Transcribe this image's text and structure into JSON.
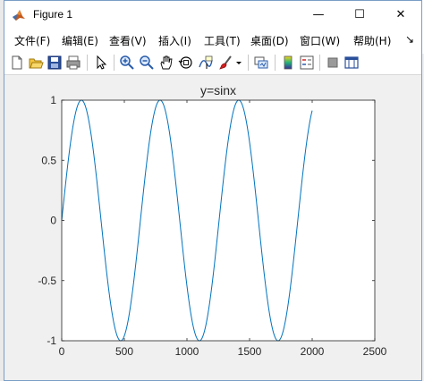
{
  "window": {
    "title": "Figure 1",
    "minimize_glyph": "—",
    "maximize_glyph": "☐",
    "close_glyph": "✕"
  },
  "menu": [
    {
      "label": "文件(F)"
    },
    {
      "label": "编辑(E)"
    },
    {
      "label": "查看(V)"
    },
    {
      "label": "插入(I)"
    },
    {
      "label": "工具(T)"
    },
    {
      "label": "桌面(D)"
    },
    {
      "label": "窗口(W)"
    },
    {
      "label": "帮助(H)"
    },
    {
      "label": "↘"
    }
  ],
  "toolbar": {
    "icons": [
      "new-figure-icon",
      "open-file-icon",
      "save-icon",
      "print-icon",
      "pointer-icon",
      "zoom-in-icon",
      "zoom-out-icon",
      "pan-icon",
      "rotate-3d-icon",
      "data-cursor-icon",
      "brush-icon",
      "brush-dropdown-icon",
      "link-plot-icon",
      "colorbar-icon",
      "legend-icon",
      "hide-plot-tools-icon",
      "show-plot-tools-icon"
    ]
  },
  "colors": {
    "line": "#0072bd",
    "axes_bg": "#ffffff",
    "figure_bg": "#f0f0f0"
  },
  "chart_data": {
    "type": "line",
    "title": "y=sinx",
    "xlabel": "",
    "ylabel": "",
    "xlim": [
      0,
      2500
    ],
    "ylim": [
      -1,
      1
    ],
    "xticks": [
      "0",
      "500",
      "1000",
      "1500",
      "2000",
      "2500"
    ],
    "yticks": [
      "-1",
      "-0.5",
      "0",
      "0.5",
      "1"
    ],
    "grid": false,
    "series": [
      {
        "function": "sin(x/100)",
        "x_start": 0,
        "x_end": 2000,
        "x_step": 1,
        "period": 628.3
      }
    ]
  }
}
